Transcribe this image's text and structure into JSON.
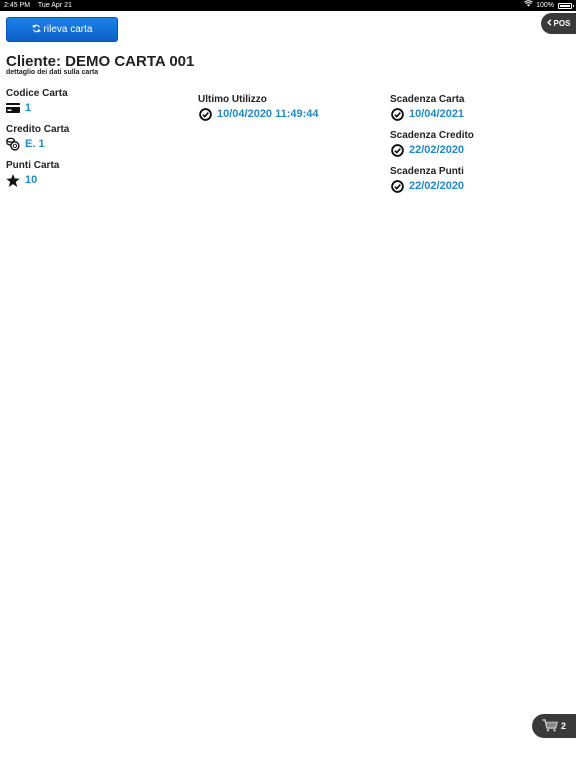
{
  "status_bar": {
    "time": "2:45 PM",
    "date": "Tue Apr 21",
    "battery": "100%"
  },
  "toolbar": {
    "rileva_label": "rileva carta",
    "pos_label": "POS"
  },
  "header": {
    "title": "Cliente: DEMO CARTA 001",
    "subtitle": "dettaglio dei dati sulla carta"
  },
  "fields": {
    "codice_carta": {
      "label": "Codice Carta",
      "value": "1",
      "icon": "card-icon"
    },
    "credito_carta": {
      "label": "Credito Carta",
      "value": "E. 1",
      "icon": "coins-icon"
    },
    "punti_carta": {
      "label": "Punti Carta",
      "value": "10",
      "icon": "star-icon"
    },
    "ultimo_utilizzo": {
      "label": "Ultimo Utilizzo",
      "value": "10/04/2020 11:49:44",
      "icon": "clock-check-icon"
    },
    "scadenza_carta": {
      "label": "Scadenza Carta",
      "value": "10/04/2021",
      "icon": "clock-check-icon"
    },
    "scadenza_credito": {
      "label": "Scadenza Credito",
      "value": "22/02/2020",
      "icon": "clock-check-icon"
    },
    "scadenza_punti": {
      "label": "Scadenza Punti",
      "value": "22/02/2020",
      "icon": "clock-check-icon"
    }
  },
  "cart": {
    "count": "2",
    "icon": "cart-icon"
  },
  "colors": {
    "accent_blue": "#1f8ac4",
    "button_blue": "#1473d9",
    "dark_pill": "#3a3a3a"
  }
}
